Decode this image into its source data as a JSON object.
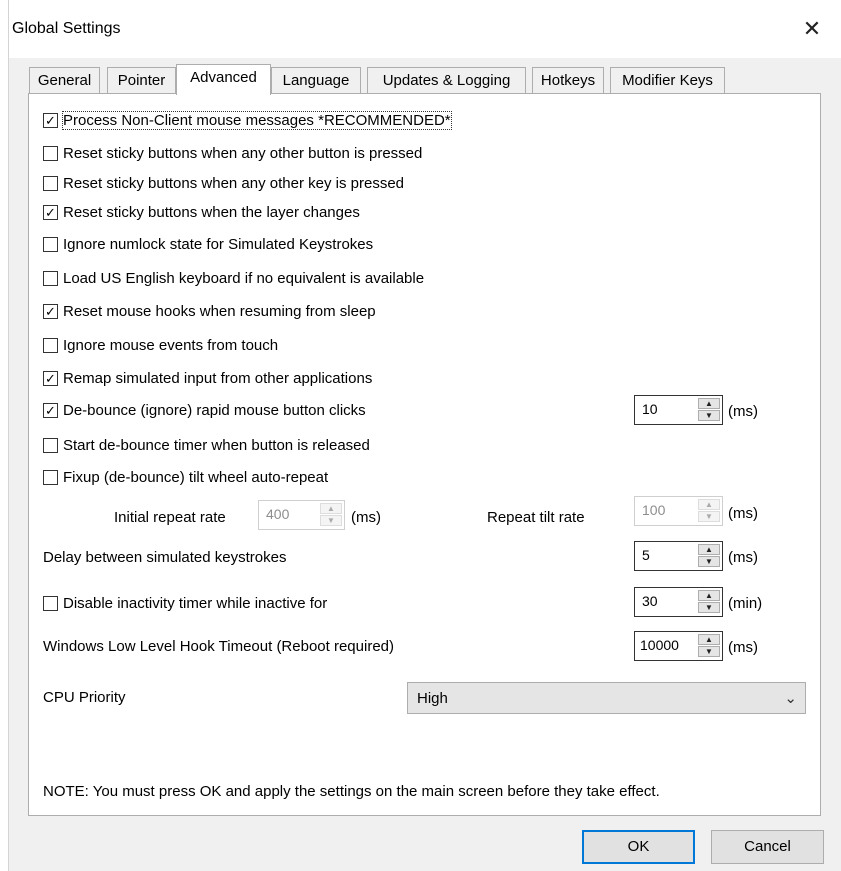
{
  "window": {
    "title": "Global Settings",
    "close_glyph": "✕"
  },
  "tabs": [
    {
      "label": "General"
    },
    {
      "label": "Pointer"
    },
    {
      "label": "Advanced"
    },
    {
      "label": "Language"
    },
    {
      "label": "Updates & Logging"
    },
    {
      "label": "Hotkeys"
    },
    {
      "label": "Modifier Keys"
    }
  ],
  "active_tab": "Advanced",
  "checkboxes": [
    {
      "label": "Process Non-Client mouse messages *RECOMMENDED*",
      "checked": true
    },
    {
      "label": "Reset sticky buttons when any other button is pressed",
      "checked": false
    },
    {
      "label": "Reset sticky buttons when any other key is pressed",
      "checked": false
    },
    {
      "label": "Reset sticky buttons when the layer changes",
      "checked": true
    },
    {
      "label": "Ignore numlock state for Simulated Keystrokes",
      "checked": false
    },
    {
      "label": "Load US English keyboard if no equivalent is available",
      "checked": false
    },
    {
      "label": "Reset mouse hooks when resuming from sleep",
      "checked": true
    },
    {
      "label": "Ignore mouse events from touch",
      "checked": false
    },
    {
      "label": "Remap simulated input from other applications",
      "checked": true
    },
    {
      "label": "De-bounce (ignore) rapid mouse button clicks",
      "checked": true
    },
    {
      "label": "Start de-bounce timer when button is released",
      "checked": false
    },
    {
      "label": "Fixup (de-bounce) tilt wheel auto-repeat",
      "checked": false
    },
    {
      "label": "Disable inactivity timer while inactive for",
      "checked": false
    }
  ],
  "check_glyph": "✓",
  "spinners": {
    "debounce": {
      "value": "10",
      "unit": "(ms)"
    },
    "initial_repeat": {
      "label": "Initial repeat rate",
      "value": "400",
      "unit": "(ms)"
    },
    "repeat_tilt": {
      "label": "Repeat tilt rate",
      "value": "100",
      "unit": "(ms)"
    },
    "delay": {
      "label": "Delay between simulated keystrokes",
      "value": "5",
      "unit": "(ms)"
    },
    "inactivity": {
      "value": "30",
      "unit": "(min)"
    },
    "hook_timeout": {
      "label": "Windows Low Level Hook Timeout (Reboot required)",
      "value": "10000",
      "unit": "(ms)"
    }
  },
  "spin_glyphs": {
    "up": "▲",
    "down": "▼"
  },
  "cpu_priority": {
    "label": "CPU Priority",
    "value": "High",
    "arrow": "⌄"
  },
  "note": "NOTE: You must press OK and apply the settings on the main screen before they take effect.",
  "buttons": {
    "ok": "OK",
    "cancel": "Cancel"
  }
}
